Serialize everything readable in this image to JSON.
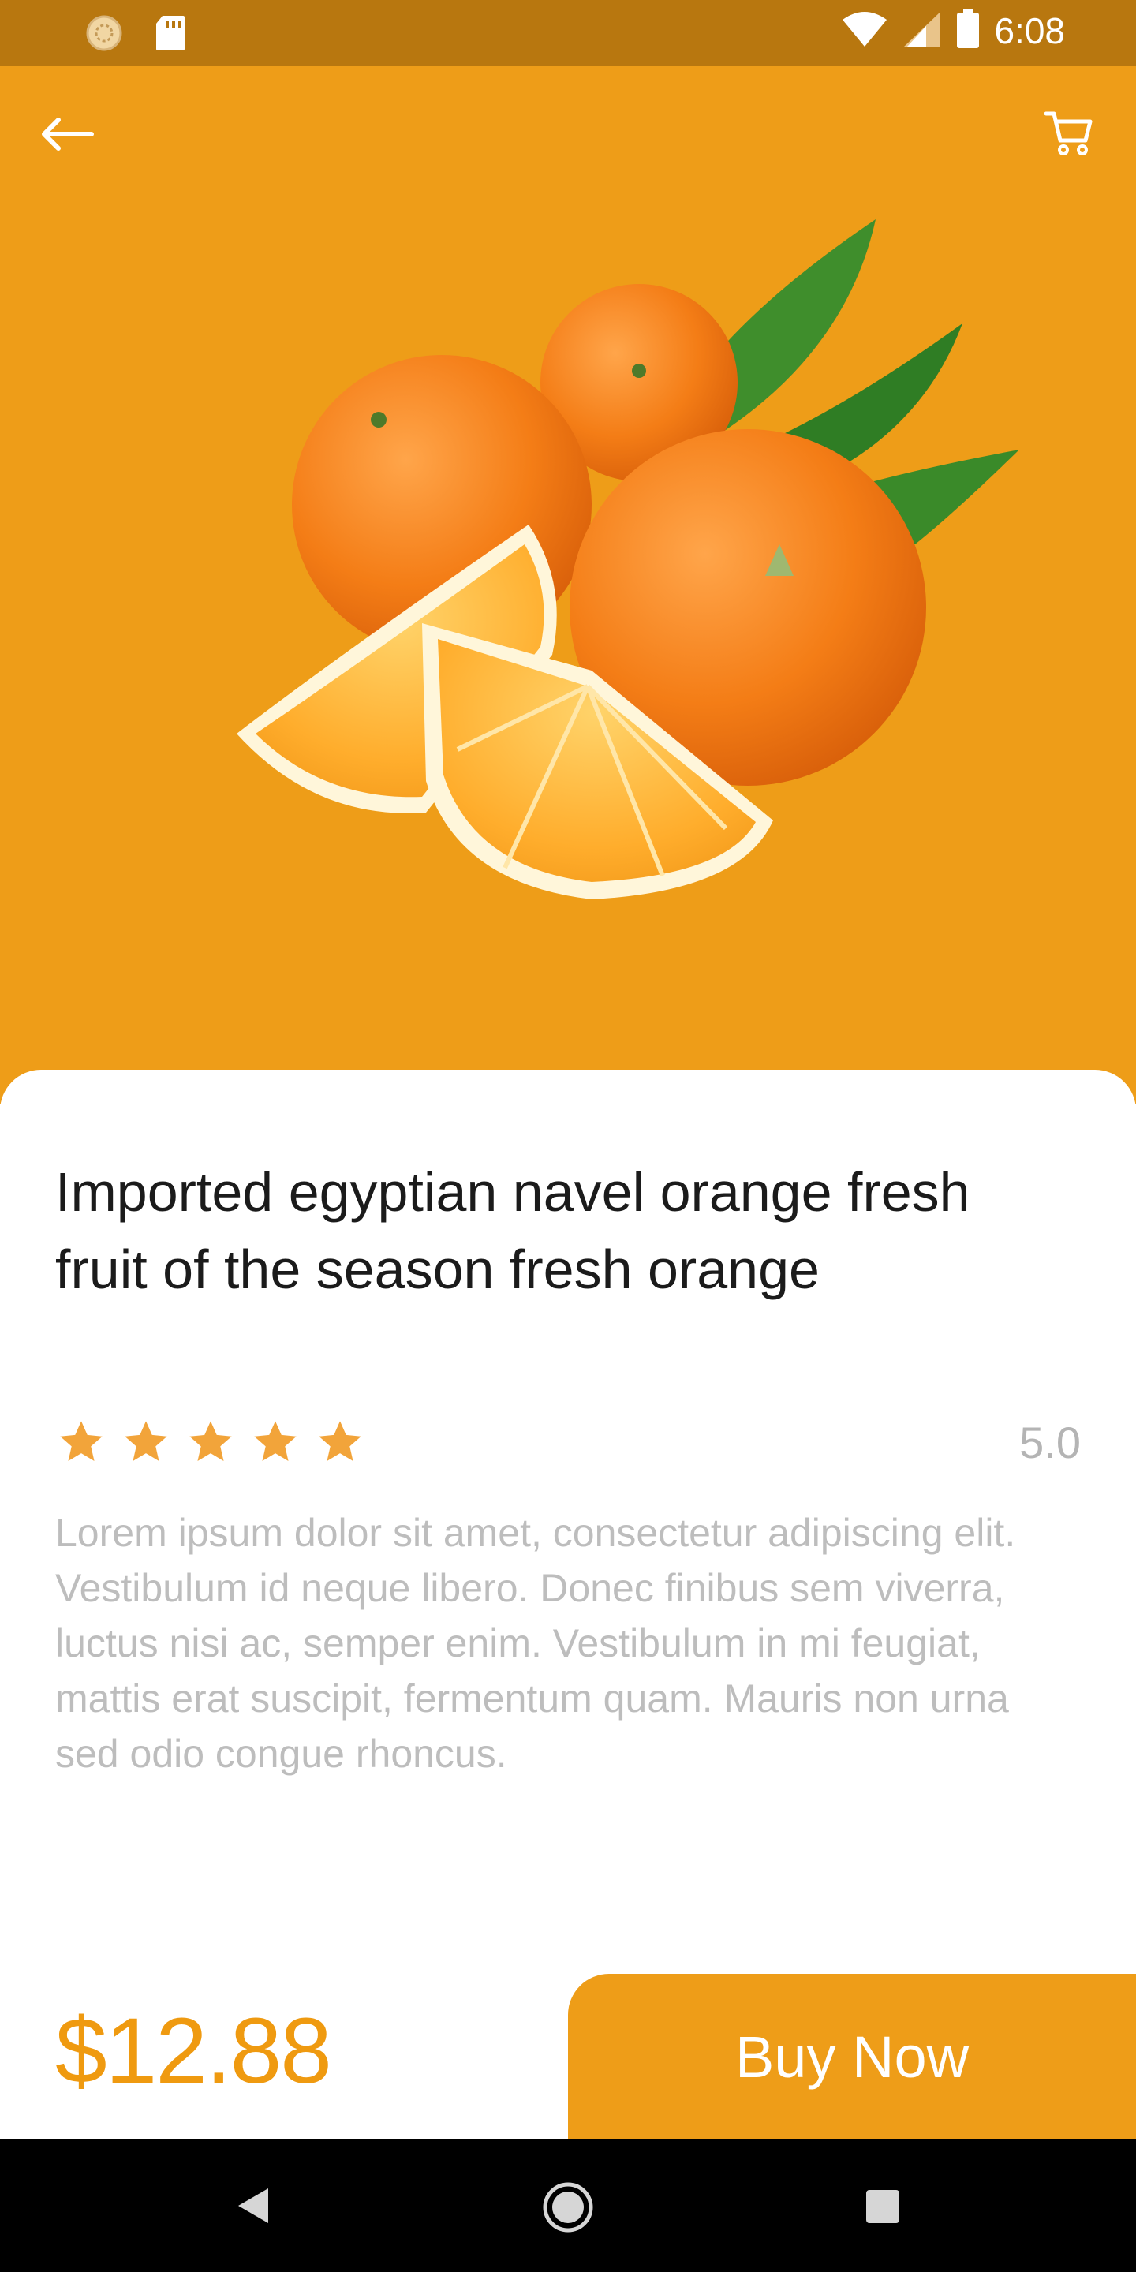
{
  "status_bar": {
    "time": "6:08",
    "icons": [
      "loading-icon",
      "sd-card-icon",
      "wifi-icon",
      "signal-icon",
      "battery-icon"
    ]
  },
  "header": {
    "back_icon": "arrow-left-icon",
    "cart_icon": "cart-icon"
  },
  "product": {
    "title": "Imported egyptian navel orange fresh fruit of the season fresh orange",
    "rating": "5.0",
    "rating_value": 5,
    "rating_max": 5,
    "description": "Lorem ipsum dolor sit amet, consectetur adipiscing elit. Vestibulum id neque libero. Donec finibus sem viverra, luctus nisi ac, semper enim. Vestibulum in mi feugiat, mattis erat suscipit, fermentum quam. Mauris non urna sed odio congue rhoncus.",
    "price": "$12.88"
  },
  "actions": {
    "buy_label": "Buy Now"
  },
  "colors": {
    "accent": "#ee9d18",
    "status_bar": "#b8770f",
    "price": "#ef9a10",
    "star": "#f2a43a"
  },
  "nav": {
    "icons": [
      "nav-back-icon",
      "nav-home-icon",
      "nav-recents-icon"
    ]
  }
}
